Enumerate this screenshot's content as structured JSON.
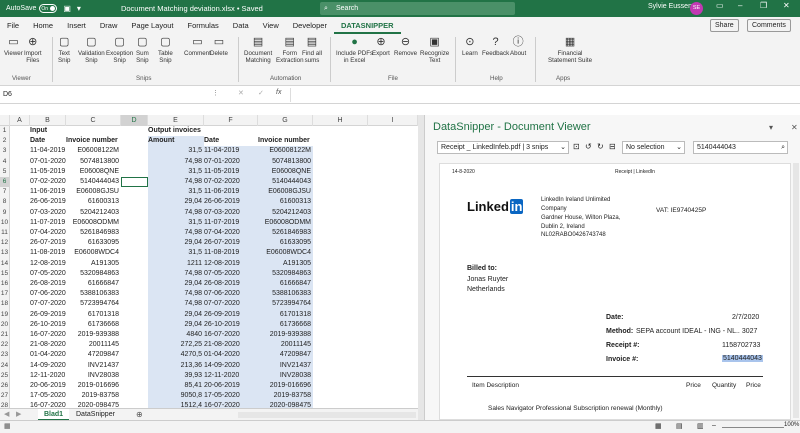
{
  "titlebar": {
    "autosave_label": "AutoSave",
    "autosave_state": "On",
    "doc_title": "Document Matching deviation.xlsx • Saved",
    "search_placeholder": "Search",
    "user_name": "Sylvie Eussen",
    "user_initials": "SE"
  },
  "menu": {
    "tabs": [
      "File",
      "Home",
      "Insert",
      "Draw",
      "Page Layout",
      "Formulas",
      "Data",
      "View",
      "Developer",
      "DATASNIPPER"
    ],
    "active": "DATASNIPPER",
    "share_label": "Share",
    "comments_label": "Comments"
  },
  "ribbon": {
    "buttons": [
      {
        "label": "Viewer",
        "sub": "",
        "icon": "viewer-icon",
        "glyph": "▭"
      },
      {
        "label": "Import",
        "sub": "Files",
        "icon": "import-icon",
        "glyph": "⊕"
      },
      {
        "label": "Text",
        "sub": "Snip",
        "icon": "text-snip-icon",
        "glyph": "▢"
      },
      {
        "label": "Validation",
        "sub": "Snip",
        "icon": "validation-snip-icon",
        "glyph": "▢"
      },
      {
        "label": "Exception",
        "sub": "Snip",
        "icon": "exception-snip-icon",
        "glyph": "▢"
      },
      {
        "label": "Sum",
        "sub": "Snip",
        "icon": "sum-snip-icon",
        "glyph": "▢"
      },
      {
        "label": "Table",
        "sub": "Snip",
        "icon": "table-snip-icon",
        "glyph": "▢"
      },
      {
        "label": "Comment",
        "sub": "",
        "icon": "comment-icon",
        "glyph": "▭"
      },
      {
        "label": "Delete",
        "sub": "",
        "icon": "delete-icon",
        "glyph": "▭"
      },
      {
        "label": "Document",
        "sub": "Matching",
        "icon": "document-matching-icon",
        "glyph": "▤"
      },
      {
        "label": "Form",
        "sub": "Extraction",
        "icon": "form-extraction-icon",
        "glyph": "▤"
      },
      {
        "label": "Find all",
        "sub": "sums",
        "icon": "find-sums-icon",
        "glyph": "▤"
      },
      {
        "label": "Include PDFs",
        "sub": "in Excel",
        "icon": "toggle-icon",
        "glyph": "●"
      },
      {
        "label": "Export",
        "sub": "",
        "icon": "export-icon",
        "glyph": "⊕"
      },
      {
        "label": "Remove",
        "sub": "",
        "icon": "remove-icon",
        "glyph": "⊖"
      },
      {
        "label": "Recognize",
        "sub": "Text",
        "icon": "recognize-text-icon",
        "glyph": "▣"
      },
      {
        "label": "Learn",
        "sub": "",
        "icon": "learn-icon",
        "glyph": "⊙"
      },
      {
        "label": "Feedback",
        "sub": "",
        "icon": "feedback-icon",
        "glyph": "?"
      },
      {
        "label": "About",
        "sub": "",
        "icon": "about-icon",
        "glyph": "ⓘ"
      },
      {
        "label": "Financial",
        "sub": "Statement Suite",
        "icon": "financial-suite-icon",
        "glyph": "▦"
      }
    ],
    "groups": [
      "Viewer",
      "Snips",
      "Automation",
      "File",
      "Help",
      "Apps"
    ]
  },
  "formula_bar": {
    "name_box": "D6",
    "fx": "fx"
  },
  "columns": [
    "A",
    "B",
    "C",
    "D",
    "E",
    "F",
    "G",
    "H",
    "I"
  ],
  "rows": [
    {
      "n": "1",
      "b": "Input",
      "e": "Output invoices"
    },
    {
      "n": "2",
      "b": "Date",
      "c": "Invoice number",
      "e": "Amount",
      "f": "Date",
      "g": "Invoice number"
    },
    {
      "n": "3",
      "b": "11-04-2019",
      "c": "E06008122M",
      "e": "31,5",
      "f": "11-04-2019",
      "g": "E06008122M"
    },
    {
      "n": "4",
      "b": "07-01-2020",
      "c": "5074813800",
      "e": "74,98",
      "f": "07-01-2020",
      "g": "5074813800"
    },
    {
      "n": "5",
      "b": "11-05-2019",
      "c": "E06008QNE",
      "e": "31,5",
      "f": "11-05-2019",
      "g": "E06008QNE"
    },
    {
      "n": "6",
      "b": "07-02-2020",
      "c": "5140444043",
      "e": "74,98",
      "f": "07-02-2020",
      "g": "5140444043"
    },
    {
      "n": "7",
      "b": "11-06-2019",
      "c": "E06008GJSU",
      "e": "31,5",
      "f": "11-06-2019",
      "g": "E06008GJSU"
    },
    {
      "n": "8",
      "b": "26-06-2019",
      "c": "61600313",
      "e": "29,04",
      "f": "26-06-2019",
      "g": "61600313"
    },
    {
      "n": "9",
      "b": "07-03-2020",
      "c": "5204212403",
      "e": "74,98",
      "f": "07-03-2020",
      "g": "5204212403"
    },
    {
      "n": "10",
      "b": "11-07-2019",
      "c": "E06008ODMM",
      "e": "31,5",
      "f": "11-07-2019",
      "g": "E06008ODMM"
    },
    {
      "n": "11",
      "b": "07-04-2020",
      "c": "5261846983",
      "e": "74,98",
      "f": "07-04-2020",
      "g": "5261846983"
    },
    {
      "n": "12",
      "b": "26-07-2019",
      "c": "61633095",
      "e": "29,04",
      "f": "26-07-2019",
      "g": "61633095"
    },
    {
      "n": "13",
      "b": "11-08-2019",
      "c": "E06008WDC4",
      "e": "31,5",
      "f": "11-08-2019",
      "g": "E06008WDC4"
    },
    {
      "n": "14",
      "b": "12-08-2019",
      "c": "A191305",
      "e": "1211",
      "f": "12-08-2019",
      "g": "A191305"
    },
    {
      "n": "15",
      "b": "07-05-2020",
      "c": "5320984863",
      "e": "74,98",
      "f": "07-05-2020",
      "g": "5320984863"
    },
    {
      "n": "16",
      "b": "26-08-2019",
      "c": "61666847",
      "e": "29,04",
      "f": "26-08-2019",
      "g": "61666847"
    },
    {
      "n": "17",
      "b": "07-06-2020",
      "c": "5388106383",
      "e": "74,98",
      "f": "07-06-2020",
      "g": "5388106383"
    },
    {
      "n": "18",
      "b": "07-07-2020",
      "c": "5723994764",
      "e": "74,98",
      "f": "07-07-2020",
      "g": "5723994764"
    },
    {
      "n": "19",
      "b": "26-09-2019",
      "c": "61701318",
      "e": "29,04",
      "f": "26-09-2019",
      "g": "61701318"
    },
    {
      "n": "20",
      "b": "26-10-2019",
      "c": "61736668",
      "e": "29,04",
      "f": "26-10-2019",
      "g": "61736668"
    },
    {
      "n": "21",
      "b": "16-07-2020",
      "c": "2019-939388",
      "e": "4840",
      "f": "16-07-2020",
      "g": "2019-939388"
    },
    {
      "n": "22",
      "b": "21-08-2020",
      "c": "20011145",
      "e": "272,25",
      "f": "21-08-2020",
      "g": "20011145"
    },
    {
      "n": "23",
      "b": "01-04-2020",
      "c": "47209847",
      "e": "4270,5",
      "f": "01-04-2020",
      "g": "47209847"
    },
    {
      "n": "24",
      "b": "14-09-2020",
      "c": "INV21437",
      "e": "213,36",
      "f": "14-09-2020",
      "g": "INV21437"
    },
    {
      "n": "25",
      "b": "12-11-2020",
      "c": "INV28038",
      "e": "39,93",
      "f": "12-11-2020",
      "g": "INV28038"
    },
    {
      "n": "26",
      "b": "20-06-2019",
      "c": "2019-016696",
      "e": "85,41",
      "f": "20-06-2019",
      "g": "2019-016696"
    },
    {
      "n": "27",
      "b": "17-05-2020",
      "c": "2019-83758",
      "e": "9050,8",
      "f": "17-05-2020",
      "g": "2019-83758"
    },
    {
      "n": "28",
      "b": "16-07-2020",
      "c": "2020-098475",
      "e": "1512,4",
      "f": "16-07-2020",
      "g": "2020-098475"
    }
  ],
  "sheets": [
    "Blad1",
    "DataSnipper"
  ],
  "active_sheet": "Blad1",
  "status": {
    "zoom": "100%"
  },
  "viewer": {
    "title": "DataSnipper - Document Viewer",
    "file_select": "Receipt _ LinkedInfeb.pdf | 3 snips",
    "selection": "No selection",
    "search_value": "5140444043",
    "doc": {
      "date_top": "14-8-2020",
      "header_right": "Receipt | LinkedIn",
      "logo_text": "Linked",
      "logo_in": "in",
      "company": [
        "LinkedIn Ireland Unlimited",
        "Company",
        "Gardner House, Wilton Plaza,",
        "Dublin 2, Ireland",
        "NL02RABO0426743748"
      ],
      "vat": "VAT: IE9740425P",
      "billed_to_label": "Billed to:",
      "billed_to": [
        "Jonas Ruyter",
        "Netherlands"
      ],
      "fields": [
        {
          "label": "Date:",
          "value": "2/7/2020"
        },
        {
          "label": "Method:",
          "value": "SEPA account IDEAL - ING - NL.. 3027"
        },
        {
          "label": "Receipt #:",
          "value": "1158702733"
        },
        {
          "label": "Invoice #:",
          "value": "5140444043"
        }
      ],
      "table_headers": [
        "Item Description",
        "Price",
        "Quantity",
        "Price"
      ],
      "item_line": "Sales Navigator Professional Subscription renewal (Monthly)"
    }
  }
}
